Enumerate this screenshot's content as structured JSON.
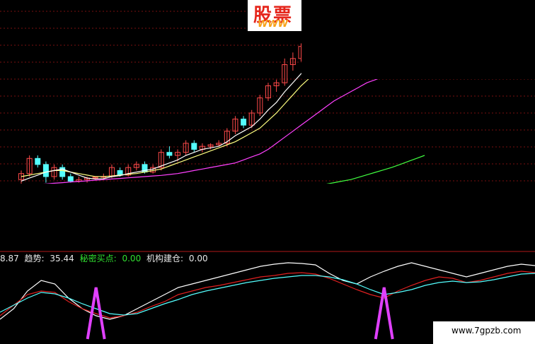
{
  "logo": {
    "title": "股票",
    "subtitle": "WWW"
  },
  "watermark": "www.7gpzb.com",
  "indicator_header": {
    "lead_value": "8.87",
    "trend_label": "趋势:",
    "trend_value": "35.44",
    "secret_label": "秘密买点:",
    "secret_value": "0.00",
    "inst_label": "机构建仓:",
    "inst_value": "0.00"
  },
  "colors": {
    "background": "#000000",
    "up_candle": "#ff4a4a",
    "down_candle": "#54ffff",
    "ma_short": "#ffffff",
    "ma_mid": "#ffff80",
    "ma_long": "#ff40ff",
    "ma_longest": "#40ff40",
    "grid": "#7a1010",
    "divider": "#b01818",
    "header_white": "#e8e8e8",
    "header_cyan": "#6af0f0",
    "header_green": "#30e030",
    "trend_white": "#ffffff",
    "trend_red": "#e02020",
    "trend_cyan": "#54ffff",
    "signal_magenta": "#e040ff"
  },
  "chart_data": [
    {
      "type": "candlestick",
      "title": "",
      "x": [
        1,
        2,
        3,
        4,
        5,
        6,
        7,
        8,
        9,
        10,
        11,
        12,
        13,
        14,
        15,
        16,
        17,
        18,
        19,
        20,
        21,
        22,
        23,
        24,
        25,
        26,
        27,
        28,
        29,
        30,
        31,
        32,
        33,
        34,
        35,
        36,
        37,
        38,
        39,
        40,
        41,
        42,
        43,
        44,
        45,
        46,
        47,
        48,
        49,
        50
      ],
      "ohlc": [
        [
          30,
          33,
          27,
          32
        ],
        [
          32,
          38,
          31,
          37
        ],
        [
          37,
          38,
          34,
          35
        ],
        [
          35,
          36,
          29,
          31
        ],
        [
          31,
          35,
          30,
          34
        ],
        [
          34,
          35,
          30,
          31
        ],
        [
          31,
          32,
          29,
          29.5
        ],
        [
          29.5,
          31,
          29,
          30
        ],
        [
          30,
          31,
          29,
          30.5
        ],
        [
          30.5,
          31,
          30,
          30.8
        ],
        [
          30.8,
          32,
          30,
          31
        ],
        [
          31,
          35,
          30.5,
          34
        ],
        [
          33,
          34,
          31,
          31.5
        ],
        [
          31.5,
          35,
          31,
          34
        ],
        [
          34,
          36,
          33,
          35
        ],
        [
          35,
          36,
          32,
          32.5
        ],
        [
          32.5,
          35,
          32,
          34
        ],
        [
          34,
          40,
          33,
          39
        ],
        [
          39,
          41,
          37,
          38
        ],
        [
          38,
          40,
          36,
          39
        ],
        [
          39,
          43,
          38,
          42
        ],
        [
          42,
          43,
          39,
          40
        ],
        [
          40,
          42,
          39,
          41
        ],
        [
          41,
          42,
          40,
          41.5
        ],
        [
          41.5,
          43,
          41,
          42
        ],
        [
          42,
          47,
          41,
          46
        ],
        [
          46,
          51,
          45,
          50
        ],
        [
          50,
          51,
          47,
          48
        ],
        [
          48,
          53,
          47,
          52
        ],
        [
          52,
          58,
          51,
          57
        ],
        [
          57,
          62,
          56,
          61
        ],
        [
          61,
          63,
          59,
          62
        ],
        [
          62,
          70,
          61,
          68
        ],
        [
          68,
          72,
          66,
          70
        ],
        [
          70,
          75,
          69,
          74
        ],
        [
          74,
          75,
          72,
          73
        ],
        [
          73,
          74,
          71,
          72
        ],
        [
          72,
          74,
          71,
          72.5
        ],
        [
          72.5,
          74,
          71,
          72
        ],
        [
          72,
          73,
          70,
          71
        ],
        [
          71,
          73,
          69,
          72
        ],
        [
          72,
          75,
          71,
          73
        ],
        [
          73,
          76,
          72,
          71
        ],
        [
          71,
          72,
          69,
          70
        ],
        [
          70,
          74,
          69,
          73
        ],
        [
          73,
          74,
          72,
          72.5
        ],
        [
          72.5,
          73,
          71,
          72
        ],
        [
          72,
          74,
          71,
          73
        ],
        [
          73,
          75,
          72,
          74
        ],
        [
          74,
          76,
          73,
          75
        ]
      ],
      "ma_short": [
        29.5,
        30.5,
        31.5,
        32.5,
        33,
        33.5,
        32.5,
        31.5,
        30.5,
        30.2,
        30.3,
        31,
        31.3,
        32,
        32.5,
        33,
        33.5,
        34.5,
        35.5,
        36.5,
        38,
        39,
        40,
        40.5,
        41,
        42.5,
        44.5,
        46,
        47.5,
        50,
        53,
        55.5,
        59,
        62,
        65,
        67,
        69,
        70.5,
        71.5,
        72,
        72,
        72.5,
        72.5,
        72,
        72,
        72.5,
        72.5,
        73,
        73.5,
        74
      ],
      "ma_mid": [
        31,
        31.5,
        32,
        32.5,
        33,
        33,
        32.5,
        32,
        31.5,
        31,
        31,
        31.2,
        31.5,
        31.8,
        32,
        32.5,
        33,
        33.5,
        34.5,
        35.5,
        36.5,
        37.5,
        38.5,
        39.5,
        40.5,
        41.5,
        42.5,
        44,
        45.5,
        47,
        49.5,
        52,
        55,
        58,
        61,
        63.5,
        65.5,
        67,
        68.5,
        69.5,
        70.5,
        71,
        71.5,
        71.5,
        72,
        72,
        72,
        72.5,
        73,
        73.5
      ],
      "ma_long": [
        28,
        28.2,
        28.4,
        28.6,
        28.8,
        29,
        29.2,
        29.4,
        29.6,
        29.8,
        30,
        30.2,
        30.4,
        30.6,
        30.8,
        31,
        31.2,
        31.4,
        31.7,
        32,
        32.5,
        33,
        33.5,
        34,
        34.5,
        35,
        35.5,
        36.5,
        37.5,
        38.5,
        40,
        42,
        44,
        46,
        48,
        50,
        52,
        54,
        56,
        57.5,
        59,
        60.5,
        62,
        63,
        64,
        65,
        66,
        67,
        68,
        69
      ],
      "ma_longest": [
        18,
        18.2,
        18.4,
        18.6,
        18.8,
        19,
        19.2,
        19.4,
        19.6,
        19.8,
        20,
        20.2,
        20.4,
        20.6,
        20.8,
        21,
        21.2,
        21.4,
        21.6,
        21.8,
        22,
        22.3,
        22.6,
        22.9,
        23.2,
        23.5,
        23.8,
        24.1,
        24.4,
        24.7,
        25,
        25.5,
        26,
        26.5,
        27,
        27.5,
        28,
        28.5,
        29,
        29.5,
        30,
        30.8,
        31.6,
        32.4,
        33.2,
        34,
        35,
        36,
        37,
        38
      ],
      "ylim": [
        10,
        80
      ]
    },
    {
      "type": "line",
      "title": "",
      "xlabel": "",
      "ylabel": "",
      "ylim": [
        0,
        100
      ],
      "x": [
        1,
        2,
        3,
        4,
        5,
        6,
        7,
        8,
        9,
        10,
        11,
        12,
        13,
        14,
        15,
        16,
        17,
        18,
        19,
        20,
        21,
        22,
        23,
        24,
        25,
        26,
        27,
        28,
        29,
        30,
        31,
        32,
        33,
        34,
        35,
        36,
        37,
        38,
        39,
        40
      ],
      "series": [
        {
          "name": "趋势",
          "color": "white",
          "values": [
            20,
            35,
            60,
            75,
            70,
            50,
            35,
            25,
            20,
            25,
            35,
            45,
            55,
            65,
            70,
            75,
            80,
            85,
            90,
            95,
            98,
            100,
            99,
            97,
            85,
            75,
            70,
            80,
            88,
            95,
            100,
            95,
            90,
            85,
            80,
            85,
            90,
            95,
            98,
            96
          ]
        },
        {
          "name": "",
          "color": "red",
          "values": [
            25,
            40,
            55,
            60,
            58,
            45,
            35,
            28,
            22,
            25,
            30,
            38,
            45,
            55,
            60,
            65,
            68,
            72,
            76,
            80,
            82,
            85,
            86,
            84,
            78,
            70,
            62,
            55,
            50,
            60,
            68,
            75,
            80,
            78,
            72,
            75,
            80,
            85,
            88,
            86
          ]
        },
        {
          "name": "",
          "color": "cyan",
          "values": [
            30,
            40,
            50,
            58,
            56,
            50,
            42,
            35,
            28,
            26,
            28,
            35,
            42,
            48,
            55,
            60,
            64,
            68,
            72,
            75,
            78,
            80,
            82,
            82,
            80,
            76,
            70,
            62,
            55,
            58,
            62,
            68,
            72,
            74,
            72,
            73,
            76,
            80,
            84,
            85
          ]
        }
      ],
      "signals": [
        {
          "name": "秘密买点",
          "x": 8,
          "value": 0
        },
        {
          "name": "机构建仓",
          "x": 29,
          "value": 0
        }
      ]
    }
  ]
}
